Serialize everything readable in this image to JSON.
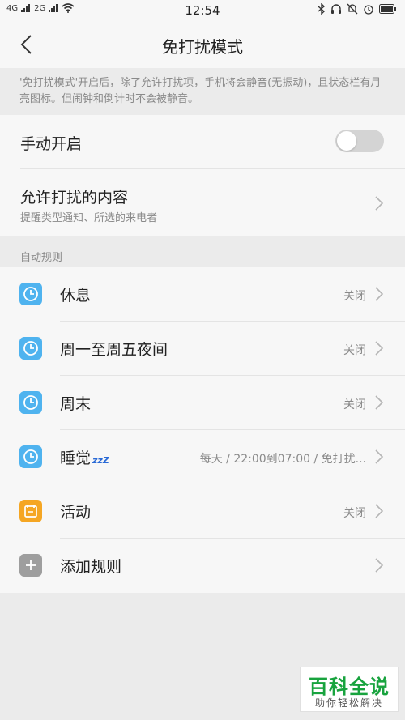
{
  "status_bar": {
    "network_1": "4G",
    "network_2": "2G",
    "time": "12:54"
  },
  "header": {
    "title": "免打扰模式"
  },
  "description": "'免打扰模式'开启后，除了允许打扰项，手机将会静音(无振动)，且状态栏有月亮图标。但闹钟和倒计时不会被静音。",
  "manual": {
    "label": "手动开启",
    "enabled": false
  },
  "allowed": {
    "label": "允许打扰的内容",
    "subtitle": "提醒类型通知、所选的来电者"
  },
  "auto_rules": {
    "section_label": "自动规则",
    "items": [
      {
        "title": "休息",
        "status": "关闭",
        "icon": "clock-icon"
      },
      {
        "title": "周一至周五夜间",
        "status": "关闭",
        "icon": "clock-icon"
      },
      {
        "title": "周末",
        "status": "关闭",
        "icon": "clock-icon"
      },
      {
        "title": "睡觉",
        "status": "每天 / 22:00到07:00 / 免打扰...",
        "icon": "clock-icon",
        "decoration": "zzZ"
      },
      {
        "title": "活动",
        "status": "关闭",
        "icon": "calendar-icon"
      },
      {
        "title": "添加规则",
        "status": "",
        "icon": "plus-icon"
      }
    ]
  },
  "colors": {
    "clock_icon": "#4fb3ef",
    "calendar_icon": "#f5a623",
    "plus_icon": "#9e9e9e",
    "watermark_green": "#18a33e"
  },
  "watermark": {
    "main": "百科全说",
    "sub": "助你轻松解决"
  }
}
